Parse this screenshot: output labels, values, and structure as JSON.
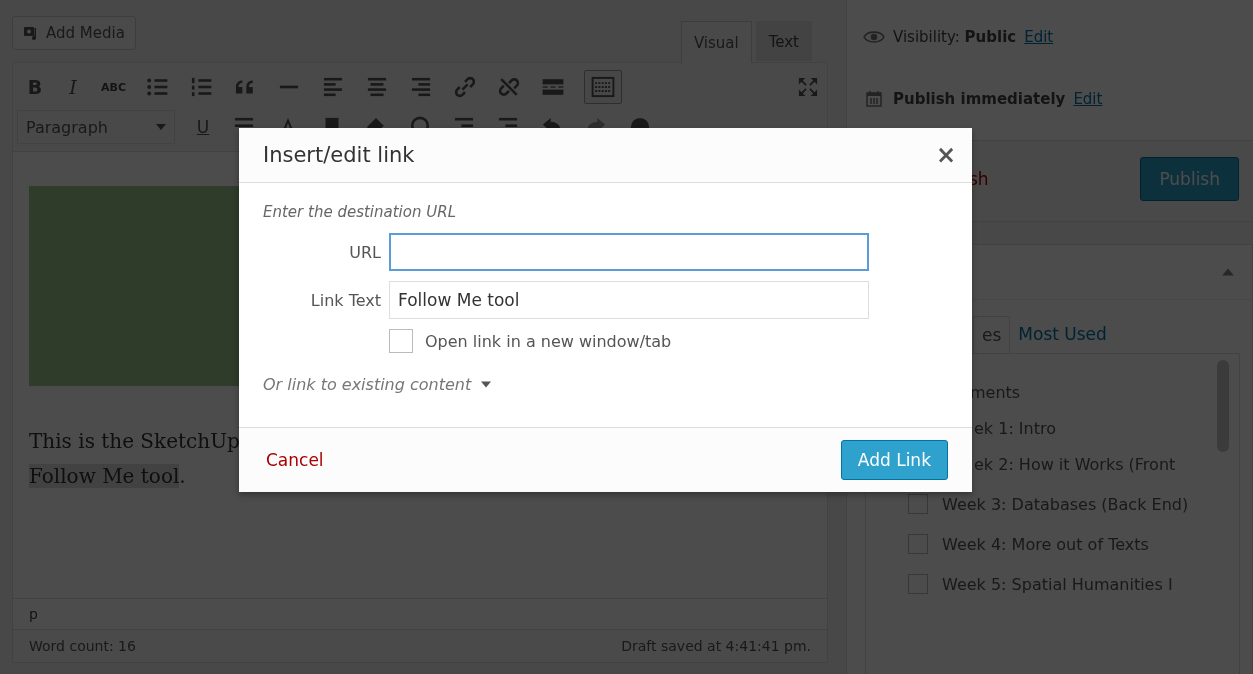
{
  "editor": {
    "add_media": "Add Media",
    "tabs": [
      {
        "label": "Visual",
        "selected": true
      },
      {
        "label": "Text",
        "selected": false
      }
    ],
    "toolbar_letters": {
      "bold": "B",
      "italic": "I",
      "strikethrough": "ABC",
      "underline": "U"
    },
    "format_select": "Paragraph",
    "content": {
      "line_1": "This is the SketchUp",
      "highlighted_text": "Follow Me tool",
      "after_highlight": "."
    },
    "path": "p",
    "word_count": "Word count: 16",
    "draft_status": "Draft saved at 4:41:41 pm."
  },
  "publish_box": {
    "visibility_label": "Visibility:",
    "visibility_value": "Public",
    "visibility_link": "Edit",
    "schedule": "Publish immediately",
    "schedule_link": "Edit",
    "trash_link_partial": "sh",
    "publish_button": "Publish"
  },
  "categories_box": {
    "expanded": true,
    "tabs": [
      {
        "label": "es",
        "selected": true
      },
      {
        "label": "Most Used",
        "selected": false
      }
    ],
    "items": [
      {
        "label": "ments",
        "children": [
          {
            "kind": "partial",
            "label": "ek 1: Intro"
          },
          {
            "kind": "partial",
            "label": "ek 2: How it Works (Front"
          },
          {
            "kind": "full",
            "label": "Week 3: Databases (Back End)",
            "checked": false
          },
          {
            "kind": "full",
            "label": "Week 4: More out of Texts",
            "checked": false
          },
          {
            "kind": "full",
            "label": "Week 5: Spatial Humanities I",
            "checked": false
          }
        ]
      }
    ]
  },
  "dialog": {
    "title": "Insert/edit link",
    "close": "×",
    "instructions": "Enter the destination URL",
    "fields": [
      {
        "label": "URL",
        "focused": true
      },
      {
        "label": "Link Text",
        "value": "Follow Me tool",
        "focused": false
      }
    ],
    "new_tab": {
      "label": "Open link in a new window/tab",
      "checked": false
    },
    "existing_content": {
      "label": "Or link to existing content",
      "expanded": false
    },
    "cancel": "Cancel",
    "submit": "Add Link"
  }
}
